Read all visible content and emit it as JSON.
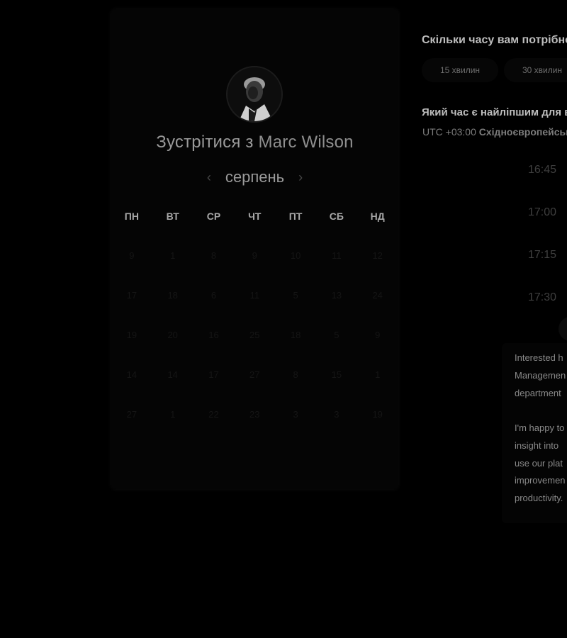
{
  "calendar": {
    "title_prefix": "Зустрітися з",
    "host_name": "Marc Wilson",
    "month": "серпень",
    "prev_icon": "‹",
    "next_icon": "›",
    "weekdays": [
      "ПН",
      "ВТ",
      "СР",
      "ЧТ",
      "ПТ",
      "СБ",
      "НД"
    ],
    "days": [
      "9",
      "1",
      "8",
      "9",
      "10",
      "11",
      "12",
      "17",
      "18",
      "6",
      "11",
      "5",
      "13",
      "24",
      "19",
      "20",
      "16",
      "25",
      "18",
      "5",
      "9",
      "14",
      "14",
      "17",
      "27",
      "8",
      "15",
      "1",
      "27",
      "1",
      "22",
      "23",
      "3",
      "3",
      "19"
    ]
  },
  "booking": {
    "duration_question": "Скільки часу вам потрібно?",
    "durations": [
      "15 хвилин",
      "30 хвилин"
    ],
    "time_question": "Який час є найліпшим для вас?",
    "timezone_offset": "UTC +03:00",
    "timezone_name": "Східноєвропейський час",
    "time_slots": [
      "16:45",
      "17:00",
      "17:15",
      "17:30"
    ]
  },
  "description": {
    "paragraph1_lines": [
      "Interested h",
      "Managemen",
      "department"
    ],
    "paragraph2_lines": [
      "I'm happy to",
      "insight into",
      "use our plat",
      "improvemen",
      "productivity."
    ]
  }
}
